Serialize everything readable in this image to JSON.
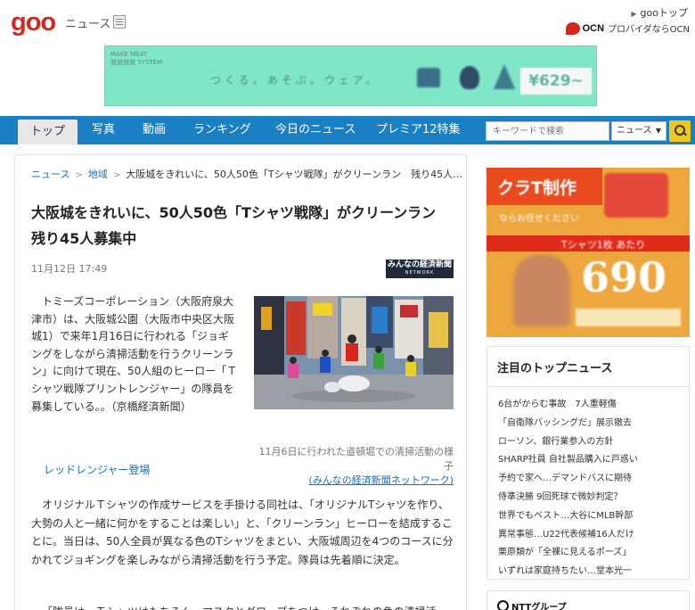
{
  "header": {
    "logo_main": "goo",
    "logo_section": "ニュース",
    "goo_top_link": "gooトップ",
    "ocn_brand": "OCN",
    "ocn_tagline": "プロバイダならOCN"
  },
  "top_banner": {
    "small_text": "MAKE MEAT\n旅旅旅旅 SYSTEM",
    "text": "つくる。あそぶ。ウェア。",
    "price": "¥629~"
  },
  "nav": {
    "tabs": [
      "トップ",
      "写真",
      "動画",
      "ランキング",
      "今日のニュース",
      "プレミア12特集"
    ],
    "active_tab": "トップ"
  },
  "search": {
    "placeholder": "キーワードで検索",
    "category": "ニュース"
  },
  "breadcrumb": {
    "items": [
      "ニュース",
      "地域"
    ],
    "current": "大阪城をきれいに、50人50色「Tシャツ戦隊」がクリーンラン　残り45人…"
  },
  "article": {
    "title": "大阪城をきれいに、50人50色「Tシャツ戦隊」がクリーンラン　残り45人募集中",
    "date": "11月12日 17:49",
    "source_logo_line1": "みんなの経済新聞",
    "source_logo_line2": "NETWORK",
    "lead": "トミーズコーポレーション（大阪府泉大津市）は、大阪城公園（大阪市中央区大阪城1）で来年1月16日に行われる「ジョギングをしながら清掃活動を行うクリーンラン」に向けて現在、50人組のヒーロー「Ｔシャツ戦隊プリントレンジャー」の隊員を募集している。。（京橋経済新聞）",
    "photo_caption": "11月6日に行われた道頓堀での清掃活動の様子",
    "photo_credit": "(みんなの経済新聞ネットワーク)",
    "subhead": "レッドレンジャー登場",
    "body": "オリジナルＴシャツの作成サービスを手掛ける同社は、「オリジナルTシャツを作り、大勢の人と一緒に何かをすることは楽しい」と、「クリーンラン」ヒーローを結成することに。当日は、50人全員が異なる色のTシャツをまとい、大阪城周辺を4つのコースに分かれてジョギングを楽しみながら清掃活動を行う予定。隊員は先着順に決定。",
    "body_more": "「隊員は、Ｔシャツはもちろん、マスクとグローブをつけ、それぞれの色の清掃活動…"
  },
  "side_ad": {
    "title": "クラT制作",
    "sub": "ならお任せください",
    "band": "Tシャツ1枚 あたり",
    "price": "690"
  },
  "side_news": {
    "title": "注目のトップニュース",
    "items": [
      "6台がからむ事故　7人重軽傷",
      "「自衛隊バッシングだ」展示撤去",
      "ローソン、銀行業参入の方針",
      "SHARP社員 自社製品購入に戸惑い",
      "予約で家へ…デマンドバスに期待",
      "侍準決勝 9回死球で微妙判定？",
      "世界でもベスト…大谷にMLB幹部",
      "異常事態…U22代表候補16人だけ",
      "栗原類が「全裸に見えるポーズ」",
      "いずれは家庭持ちたい…堂本光一"
    ]
  },
  "ntt": {
    "label": "NTTグループ"
  },
  "colors": {
    "nav_blue": "#1b80c3",
    "logo_red": "#d4281c",
    "link_blue": "#1b6fb3",
    "search_yellow": "#f4c61c"
  }
}
